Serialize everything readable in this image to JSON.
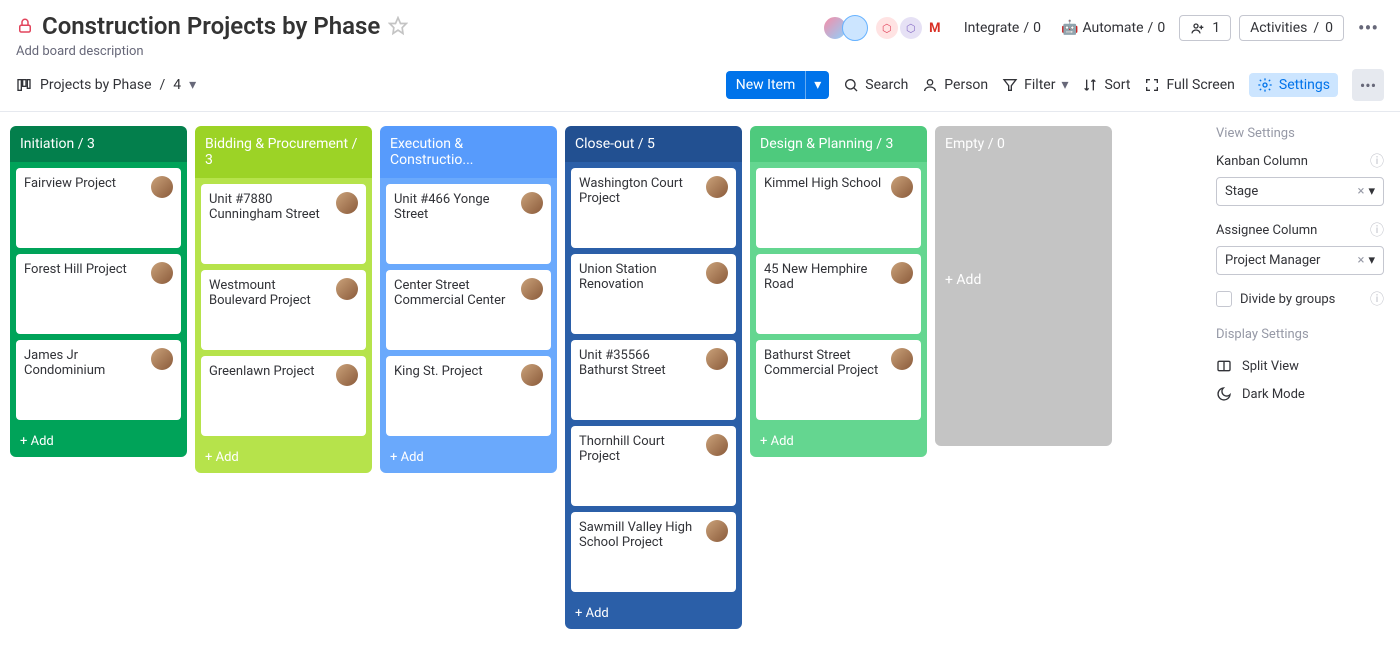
{
  "header": {
    "title": "Construction Projects by Phase",
    "description": "Add board description",
    "integrate_label": "Integrate",
    "integrate_count": 0,
    "automate_label": "Automate",
    "automate_count": 0,
    "invite_count": 1,
    "activities_label": "Activities",
    "activities_count": 0
  },
  "toolbar": {
    "view_name": "Projects by Phase",
    "view_count": 4,
    "new_item_label": "New Item",
    "search_label": "Search",
    "person_label": "Person",
    "filter_label": "Filter",
    "sort_label": "Sort",
    "fullscreen_label": "Full Screen",
    "settings_label": "Settings"
  },
  "columns": [
    {
      "name": "Initiation",
      "count": 3,
      "header_class": "c-green-dark",
      "body_class": "b-green-dark",
      "cards": [
        {
          "title": "Fairview Project"
        },
        {
          "title": "Forest Hill Project"
        },
        {
          "title": "James Jr Condominium"
        }
      ]
    },
    {
      "name": "Bidding & Procurement",
      "count": 3,
      "header_class": "c-lime",
      "body_class": "b-lime",
      "cards": [
        {
          "title": "Unit #7880 Cunningham Street"
        },
        {
          "title": "Westmount Boulevard Project"
        },
        {
          "title": "Greenlawn Project"
        }
      ]
    },
    {
      "name": "Execution & Constructio...",
      "count": null,
      "header_class": "c-blue",
      "body_class": "b-blue",
      "cards": [
        {
          "title": "Unit #466 Yonge Street"
        },
        {
          "title": "Center Street Commercial Center"
        },
        {
          "title": "King St. Project"
        }
      ]
    },
    {
      "name": "Close-out",
      "count": 5,
      "header_class": "c-navy",
      "body_class": "b-navy",
      "cards": [
        {
          "title": "Washington Court Project"
        },
        {
          "title": "Union Station Renovation"
        },
        {
          "title": "Unit #35566 Bathurst Street"
        },
        {
          "title": "Thornhill Court Project"
        },
        {
          "title": "Sawmill Valley High School Project"
        }
      ]
    },
    {
      "name": "Design & Planning",
      "count": 3,
      "header_class": "c-mint",
      "body_class": "b-mint",
      "cards": [
        {
          "title": "Kimmel High School"
        },
        {
          "title": "45 New Hemphire Road"
        },
        {
          "title": "Bathurst Street Commercial Project"
        }
      ]
    }
  ],
  "empty_column": {
    "name": "Empty",
    "count": 0,
    "add_label": "+ Add"
  },
  "add_label": "+ Add",
  "settings_panel": {
    "view_settings_title": "View Settings",
    "kanban_column_label": "Kanban Column",
    "kanban_column_value": "Stage",
    "assignee_column_label": "Assignee Column",
    "assignee_column_value": "Project Manager",
    "divide_label": "Divide by groups",
    "display_settings_title": "Display Settings",
    "split_view_label": "Split View",
    "dark_mode_label": "Dark Mode"
  }
}
